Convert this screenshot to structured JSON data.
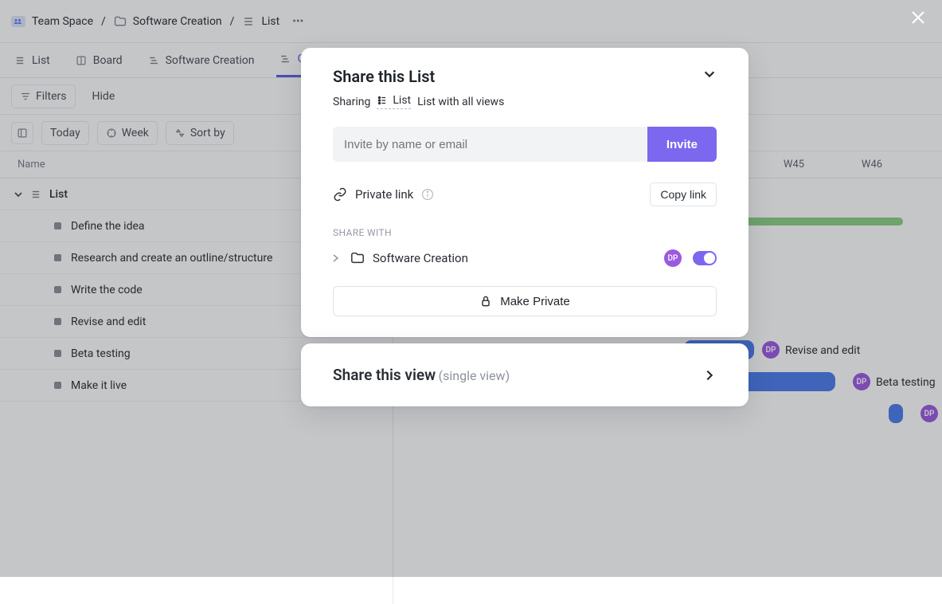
{
  "breadcrumb": {
    "team": "Team Space",
    "folder": "Software Creation",
    "item": "List"
  },
  "tabs": [
    "List",
    "Board",
    "Software Creation",
    "G"
  ],
  "toolbar": {
    "filters": "Filters",
    "hide": "Hide",
    "today": "Today",
    "week": "Week",
    "sortby": "Sort by"
  },
  "columns": {
    "name": "Name"
  },
  "weeks": [
    "W45",
    "W46"
  ],
  "group": {
    "title": "List"
  },
  "tasks": [
    {
      "name": "Define the idea"
    },
    {
      "name": "Research and create an outline/structure"
    },
    {
      "name": "Write the code"
    },
    {
      "name": "Revise and edit"
    },
    {
      "name": "Beta testing"
    },
    {
      "name": "Make it live"
    }
  ],
  "gantt_labels": {
    "revise": "Revise and edit",
    "beta": "Beta testing"
  },
  "avatar_initials": "DP",
  "modal": {
    "title": "Share this List",
    "sharing_label": "Sharing",
    "scope_label": "List",
    "scope_desc": "List with all views",
    "invite_placeholder": "Invite by name or email",
    "invite_btn": "Invite",
    "private_link": "Private link",
    "copy_link": "Copy link",
    "share_with": "SHARE WITH",
    "target": "Software Creation",
    "make_private": "Make Private",
    "view_title": "Share this view",
    "view_sub": "(single view)"
  }
}
